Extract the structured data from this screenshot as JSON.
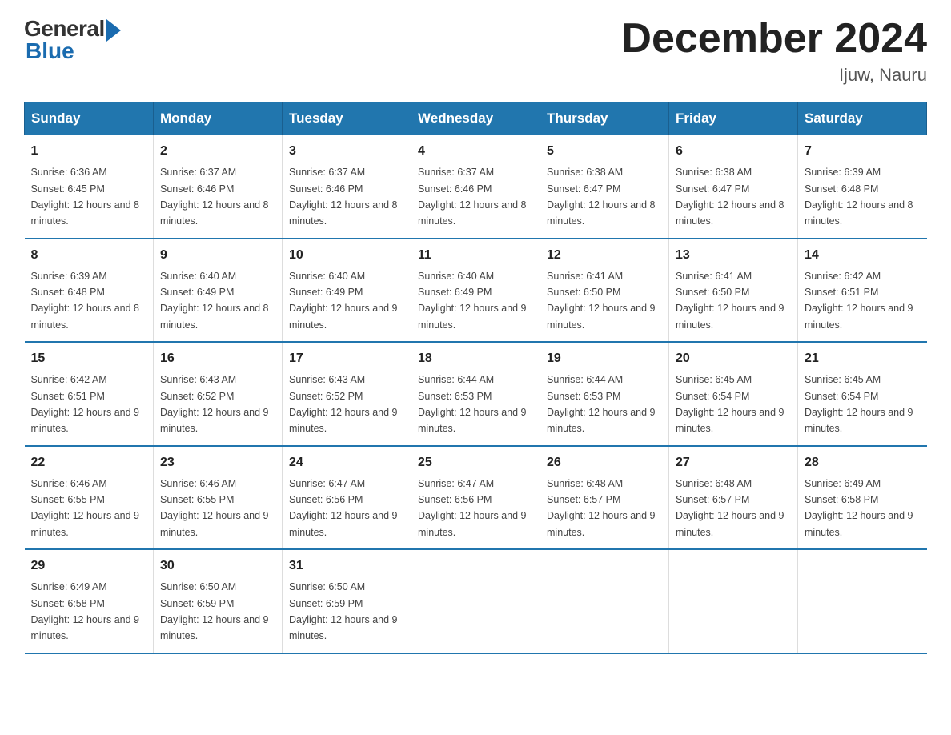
{
  "logo": {
    "general": "General",
    "blue": "Blue"
  },
  "title": "December 2024",
  "location": "Ijuw, Nauru",
  "days_header": [
    "Sunday",
    "Monday",
    "Tuesday",
    "Wednesday",
    "Thursday",
    "Friday",
    "Saturday"
  ],
  "weeks": [
    [
      {
        "num": "1",
        "sunrise": "6:36 AM",
        "sunset": "6:45 PM",
        "daylight": "12 hours and 8 minutes."
      },
      {
        "num": "2",
        "sunrise": "6:37 AM",
        "sunset": "6:46 PM",
        "daylight": "12 hours and 8 minutes."
      },
      {
        "num": "3",
        "sunrise": "6:37 AM",
        "sunset": "6:46 PM",
        "daylight": "12 hours and 8 minutes."
      },
      {
        "num": "4",
        "sunrise": "6:37 AM",
        "sunset": "6:46 PM",
        "daylight": "12 hours and 8 minutes."
      },
      {
        "num": "5",
        "sunrise": "6:38 AM",
        "sunset": "6:47 PM",
        "daylight": "12 hours and 8 minutes."
      },
      {
        "num": "6",
        "sunrise": "6:38 AM",
        "sunset": "6:47 PM",
        "daylight": "12 hours and 8 minutes."
      },
      {
        "num": "7",
        "sunrise": "6:39 AM",
        "sunset": "6:48 PM",
        "daylight": "12 hours and 8 minutes."
      }
    ],
    [
      {
        "num": "8",
        "sunrise": "6:39 AM",
        "sunset": "6:48 PM",
        "daylight": "12 hours and 8 minutes."
      },
      {
        "num": "9",
        "sunrise": "6:40 AM",
        "sunset": "6:49 PM",
        "daylight": "12 hours and 8 minutes."
      },
      {
        "num": "10",
        "sunrise": "6:40 AM",
        "sunset": "6:49 PM",
        "daylight": "12 hours and 9 minutes."
      },
      {
        "num": "11",
        "sunrise": "6:40 AM",
        "sunset": "6:49 PM",
        "daylight": "12 hours and 9 minutes."
      },
      {
        "num": "12",
        "sunrise": "6:41 AM",
        "sunset": "6:50 PM",
        "daylight": "12 hours and 9 minutes."
      },
      {
        "num": "13",
        "sunrise": "6:41 AM",
        "sunset": "6:50 PM",
        "daylight": "12 hours and 9 minutes."
      },
      {
        "num": "14",
        "sunrise": "6:42 AM",
        "sunset": "6:51 PM",
        "daylight": "12 hours and 9 minutes."
      }
    ],
    [
      {
        "num": "15",
        "sunrise": "6:42 AM",
        "sunset": "6:51 PM",
        "daylight": "12 hours and 9 minutes."
      },
      {
        "num": "16",
        "sunrise": "6:43 AM",
        "sunset": "6:52 PM",
        "daylight": "12 hours and 9 minutes."
      },
      {
        "num": "17",
        "sunrise": "6:43 AM",
        "sunset": "6:52 PM",
        "daylight": "12 hours and 9 minutes."
      },
      {
        "num": "18",
        "sunrise": "6:44 AM",
        "sunset": "6:53 PM",
        "daylight": "12 hours and 9 minutes."
      },
      {
        "num": "19",
        "sunrise": "6:44 AM",
        "sunset": "6:53 PM",
        "daylight": "12 hours and 9 minutes."
      },
      {
        "num": "20",
        "sunrise": "6:45 AM",
        "sunset": "6:54 PM",
        "daylight": "12 hours and 9 minutes."
      },
      {
        "num": "21",
        "sunrise": "6:45 AM",
        "sunset": "6:54 PM",
        "daylight": "12 hours and 9 minutes."
      }
    ],
    [
      {
        "num": "22",
        "sunrise": "6:46 AM",
        "sunset": "6:55 PM",
        "daylight": "12 hours and 9 minutes."
      },
      {
        "num": "23",
        "sunrise": "6:46 AM",
        "sunset": "6:55 PM",
        "daylight": "12 hours and 9 minutes."
      },
      {
        "num": "24",
        "sunrise": "6:47 AM",
        "sunset": "6:56 PM",
        "daylight": "12 hours and 9 minutes."
      },
      {
        "num": "25",
        "sunrise": "6:47 AM",
        "sunset": "6:56 PM",
        "daylight": "12 hours and 9 minutes."
      },
      {
        "num": "26",
        "sunrise": "6:48 AM",
        "sunset": "6:57 PM",
        "daylight": "12 hours and 9 minutes."
      },
      {
        "num": "27",
        "sunrise": "6:48 AM",
        "sunset": "6:57 PM",
        "daylight": "12 hours and 9 minutes."
      },
      {
        "num": "28",
        "sunrise": "6:49 AM",
        "sunset": "6:58 PM",
        "daylight": "12 hours and 9 minutes."
      }
    ],
    [
      {
        "num": "29",
        "sunrise": "6:49 AM",
        "sunset": "6:58 PM",
        "daylight": "12 hours and 9 minutes."
      },
      {
        "num": "30",
        "sunrise": "6:50 AM",
        "sunset": "6:59 PM",
        "daylight": "12 hours and 9 minutes."
      },
      {
        "num": "31",
        "sunrise": "6:50 AM",
        "sunset": "6:59 PM",
        "daylight": "12 hours and 9 minutes."
      },
      null,
      null,
      null,
      null
    ]
  ]
}
